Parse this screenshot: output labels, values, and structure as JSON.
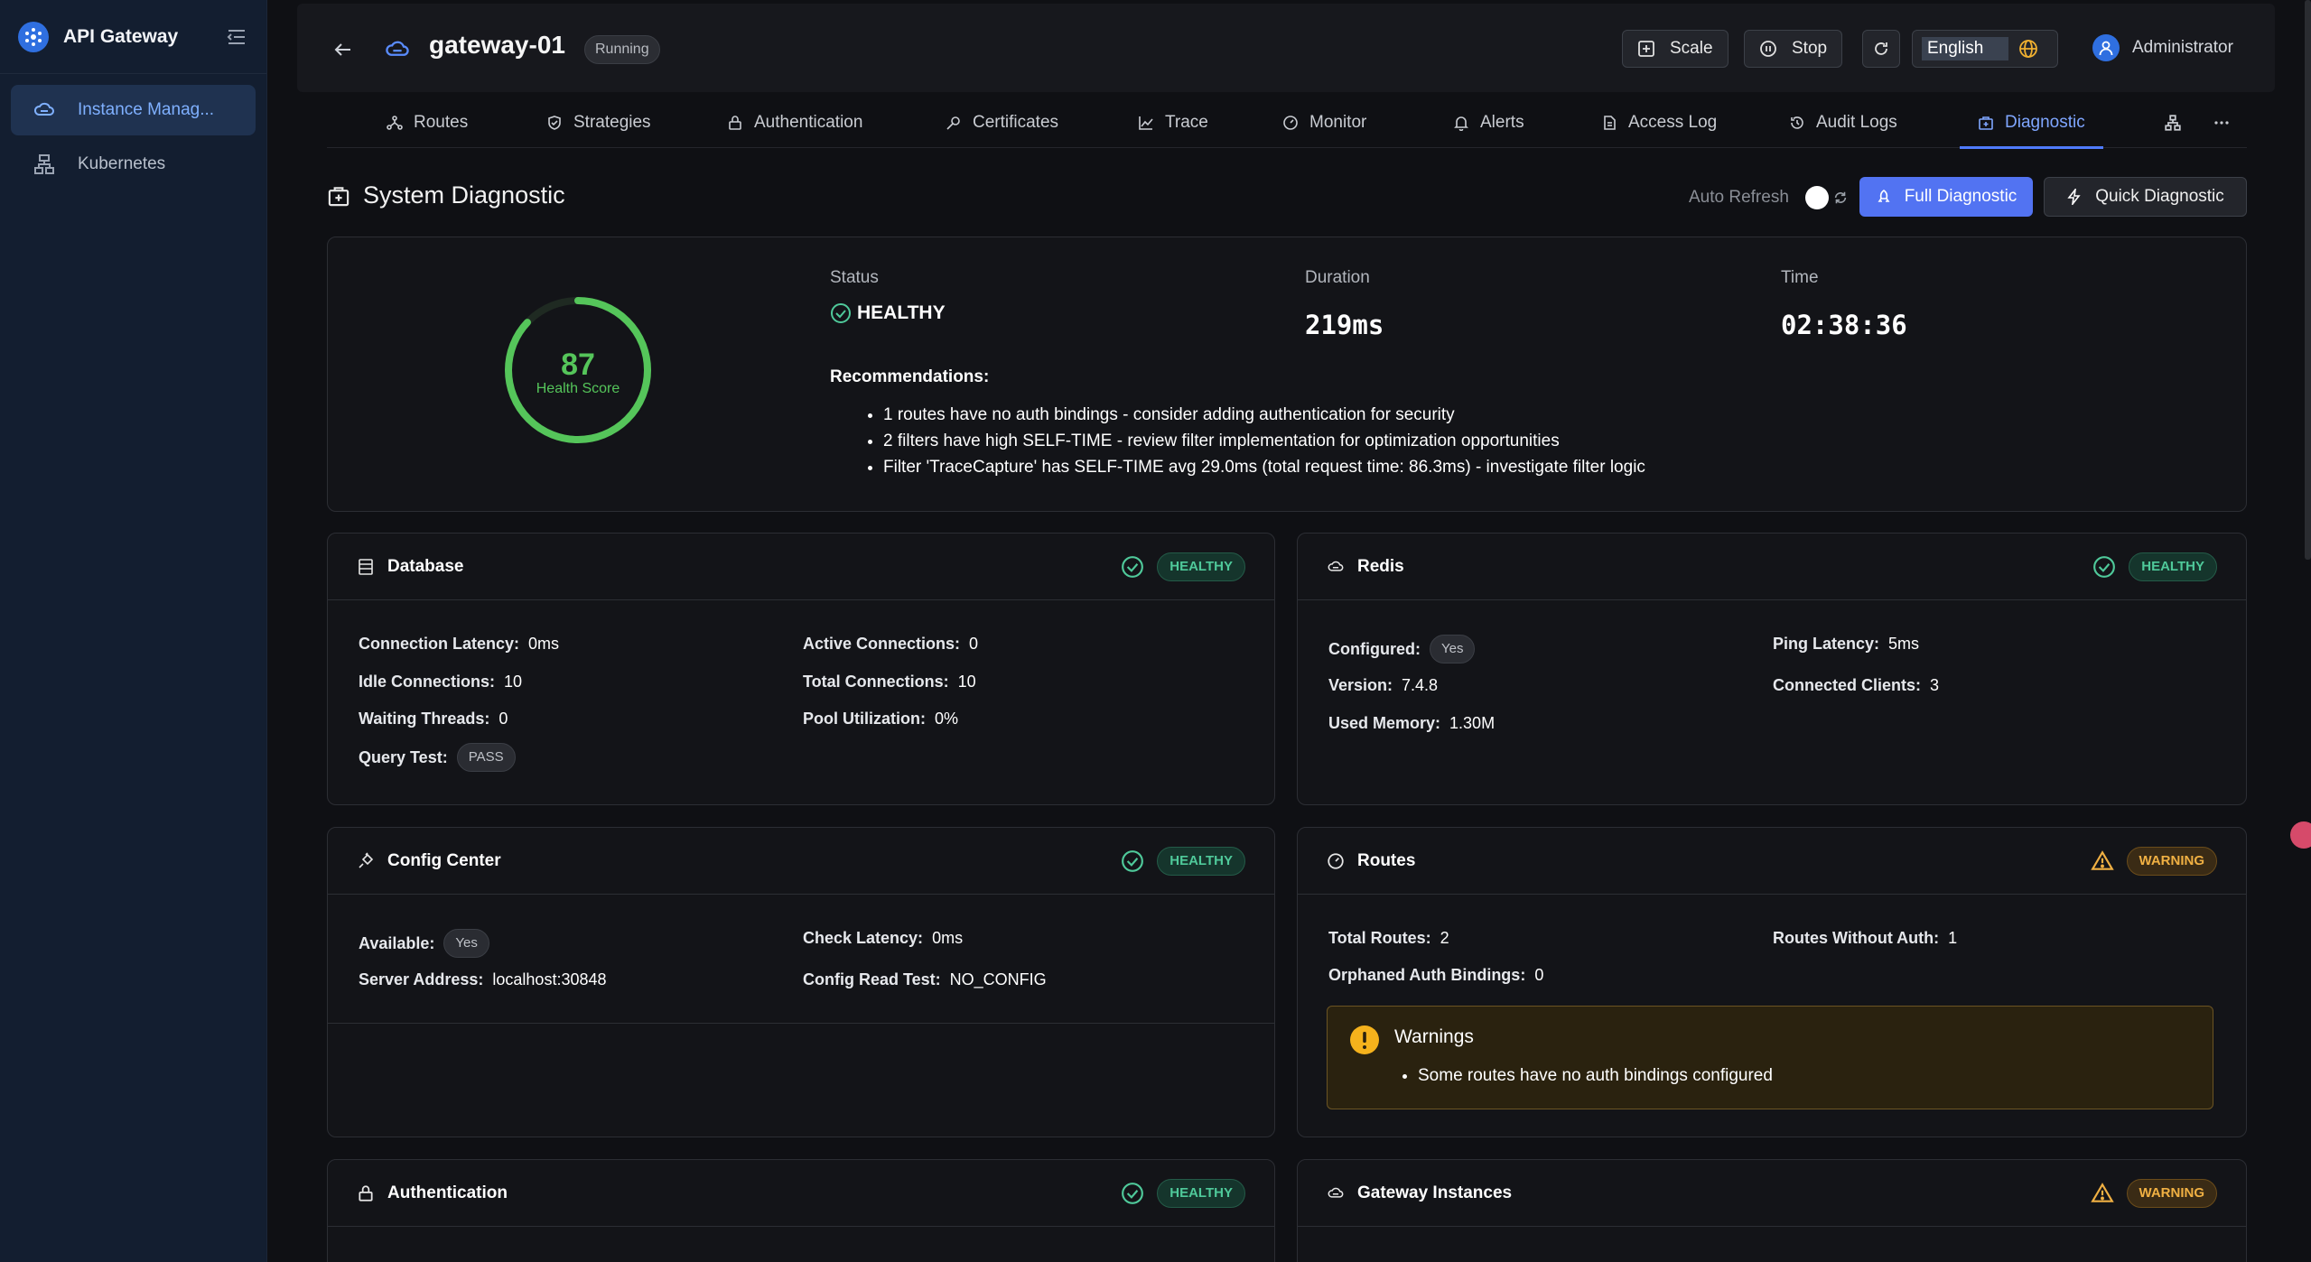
{
  "app": {
    "title": "API Gateway"
  },
  "sidebar": {
    "items": [
      {
        "label": "Instance Manag...",
        "icon": "cloud-icon",
        "active": true
      },
      {
        "label": "Kubernetes",
        "icon": "cluster-icon",
        "active": false
      }
    ]
  },
  "header": {
    "gateway_name": "gateway-01",
    "status_badge": "Running",
    "scale_label": "Scale",
    "stop_label": "Stop",
    "language": "English",
    "user": "Administrator"
  },
  "tabs": [
    {
      "label": "Routes",
      "icon": "routes-icon"
    },
    {
      "label": "Strategies",
      "icon": "shield-icon"
    },
    {
      "label": "Authentication",
      "icon": "lock-icon"
    },
    {
      "label": "Certificates",
      "icon": "key-icon"
    },
    {
      "label": "Trace",
      "icon": "chart-line-icon"
    },
    {
      "label": "Monitor",
      "icon": "gauge-icon"
    },
    {
      "label": "Alerts",
      "icon": "bell-icon"
    },
    {
      "label": "Access Log",
      "icon": "file-icon"
    },
    {
      "label": "Audit Logs",
      "icon": "history-icon"
    },
    {
      "label": "Diagnostic",
      "icon": "medkit-icon",
      "active": true
    }
  ],
  "diagnostic": {
    "title": "System Diagnostic",
    "auto_refresh_label": "Auto Refresh",
    "full_label": "Full Diagnostic",
    "quick_label": "Quick Diagnostic"
  },
  "summary": {
    "score": "87",
    "score_fraction": 0.87,
    "score_label": "Health Score",
    "status_label": "Status",
    "status_value": "HEALTHY",
    "duration_label": "Duration",
    "duration_value": "219ms",
    "time_label": "Time",
    "time_value": "02:38:36",
    "recommendations_title": "Recommendations:",
    "recommendations": [
      "1 routes have no auth bindings - consider adding authentication for security",
      "2 filters have high SELF-TIME - review filter implementation for optimization opportunities",
      "Filter 'TraceCapture' has SELF-TIME avg 29.0ms (total request time: 86.3ms) - investigate filter logic"
    ]
  },
  "cards": {
    "database": {
      "title": "Database",
      "status": "HEALTHY",
      "connection_latency_label": "Connection Latency:",
      "connection_latency": "0ms",
      "active_connections_label": "Active Connections:",
      "active_connections": "0",
      "idle_connections_label": "Idle Connections:",
      "idle_connections": "10",
      "total_connections_label": "Total Connections:",
      "total_connections": "10",
      "waiting_threads_label": "Waiting Threads:",
      "waiting_threads": "0",
      "pool_utilization_label": "Pool Utilization:",
      "pool_utilization": "0%",
      "query_test_label": "Query Test:",
      "query_test": "PASS"
    },
    "redis": {
      "title": "Redis",
      "status": "HEALTHY",
      "configured_label": "Configured:",
      "configured": "Yes",
      "ping_latency_label": "Ping Latency:",
      "ping_latency": "5ms",
      "version_label": "Version:",
      "version": "7.4.8",
      "connected_clients_label": "Connected Clients:",
      "connected_clients": "3",
      "used_memory_label": "Used Memory:",
      "used_memory": "1.30M"
    },
    "config_center": {
      "title": "Config Center",
      "status": "HEALTHY",
      "available_label": "Available:",
      "available": "Yes",
      "check_latency_label": "Check Latency:",
      "check_latency": "0ms",
      "server_address_label": "Server Address:",
      "server_address": "localhost:30848",
      "config_read_test_label": "Config Read Test:",
      "config_read_test": "NO_CONFIG"
    },
    "routes": {
      "title": "Routes",
      "status": "WARNING",
      "total_routes_label": "Total Routes:",
      "total_routes": "2",
      "routes_without_auth_label": "Routes Without Auth:",
      "routes_without_auth": "1",
      "orphaned_label": "Orphaned Auth Bindings:",
      "orphaned": "0",
      "warnings_title": "Warnings",
      "warnings": [
        "Some routes have no auth bindings configured"
      ]
    },
    "authentication": {
      "title": "Authentication",
      "status": "HEALTHY"
    },
    "gateway_instances": {
      "title": "Gateway Instances",
      "status": "WARNING"
    }
  },
  "colors": {
    "accent": "#5273f2",
    "healthy": "#4fc99a",
    "warning": "#f0b043",
    "gauge": "#55c55a"
  }
}
